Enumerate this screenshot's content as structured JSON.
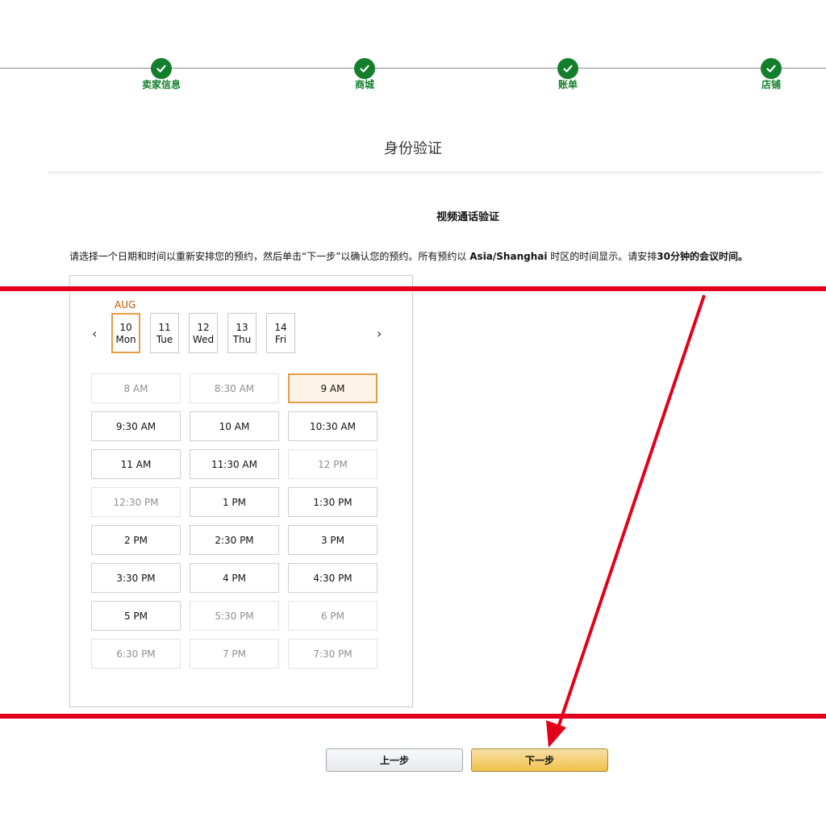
{
  "stepper": {
    "steps": [
      {
        "label": "卖家信息"
      },
      {
        "label": "商城"
      },
      {
        "label": "账单"
      },
      {
        "label": "店铺"
      }
    ],
    "color": "#137f2c"
  },
  "page_title": "身份验证",
  "section_title": "视频通话验证",
  "instructions": {
    "part1": "请选择一个日期和时间以重新安排您的预约，然后单击“下一步”以确认您的预约。所有预约以 ",
    "timezone": "Asia/Shanghai",
    "part2": " 时区的时间显示。请安排",
    "duration": "30分钟的会议时间。"
  },
  "calendar": {
    "month": "AUG",
    "prev_icon": "‹",
    "next_icon": "›",
    "days": [
      {
        "num": "10",
        "dow": "Mon",
        "selected": true
      },
      {
        "num": "11",
        "dow": "Tue",
        "selected": false
      },
      {
        "num": "12",
        "dow": "Wed",
        "selected": false
      },
      {
        "num": "13",
        "dow": "Thu",
        "selected": false
      },
      {
        "num": "14",
        "dow": "Fri",
        "selected": false
      }
    ],
    "slots": [
      {
        "label": "8 AM",
        "state": "disabled"
      },
      {
        "label": "8:30 AM",
        "state": "disabled"
      },
      {
        "label": "9 AM",
        "state": "selected"
      },
      {
        "label": "9:30 AM",
        "state": "available"
      },
      {
        "label": "10 AM",
        "state": "available"
      },
      {
        "label": "10:30 AM",
        "state": "available"
      },
      {
        "label": "11 AM",
        "state": "available"
      },
      {
        "label": "11:30 AM",
        "state": "available"
      },
      {
        "label": "12 PM",
        "state": "disabled"
      },
      {
        "label": "12:30 PM",
        "state": "disabled"
      },
      {
        "label": "1 PM",
        "state": "available"
      },
      {
        "label": "1:30 PM",
        "state": "available"
      },
      {
        "label": "2 PM",
        "state": "available"
      },
      {
        "label": "2:30 PM",
        "state": "available"
      },
      {
        "label": "3 PM",
        "state": "available"
      },
      {
        "label": "3:30 PM",
        "state": "available"
      },
      {
        "label": "4 PM",
        "state": "available"
      },
      {
        "label": "4:30 PM",
        "state": "available"
      },
      {
        "label": "5 PM",
        "state": "available"
      },
      {
        "label": "5:30 PM",
        "state": "disabled"
      },
      {
        "label": "6 PM",
        "state": "disabled"
      },
      {
        "label": "6:30 PM",
        "state": "disabled"
      },
      {
        "label": "7 PM",
        "state": "disabled"
      },
      {
        "label": "7:30 PM",
        "state": "disabled"
      }
    ],
    "accent": "#e29d47",
    "month_color": "#c45500"
  },
  "buttons": {
    "prev_label": "上一步",
    "next_label": "下一步"
  },
  "annotation_color": "#e3001b"
}
